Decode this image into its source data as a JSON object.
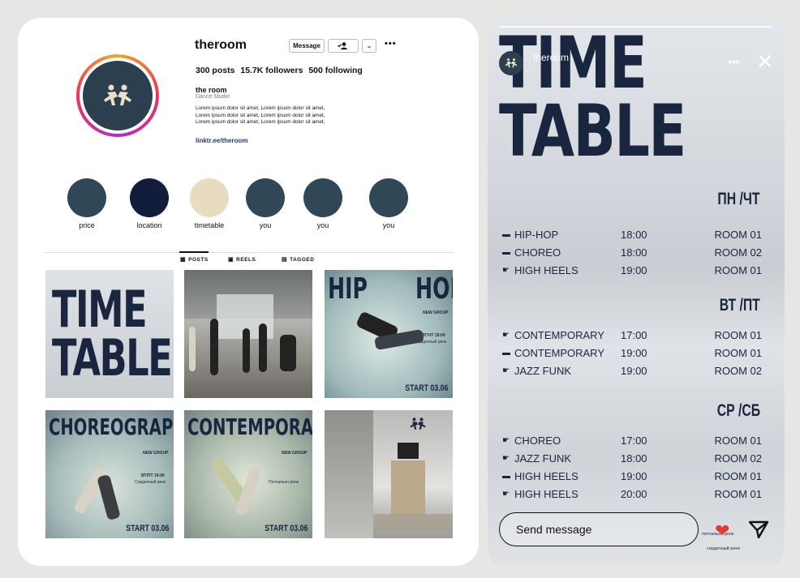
{
  "profile": {
    "username": "theroom",
    "message_button": "Message",
    "stats": {
      "posts": "300 posts",
      "followers": "15.7K followers",
      "following": "500 following"
    },
    "bio": {
      "name": "the room",
      "category": "Dance Studio",
      "text": "Lorem ipsum dolor sit amet, Lorem ipsum dolor sit amet, Lorem ipsum dolor sit amet, Lorem ipsum dolor sit amet, Lorem ipsum dolor sit amet, Lorem ipsum dolor sit amet,",
      "link": "linktr.ee/theroom"
    },
    "highlights": [
      {
        "label": "price",
        "color": "#2f4757"
      },
      {
        "label": "location",
        "color": "#121d3b"
      },
      {
        "label": "timetable",
        "color": "#e7dcc0"
      },
      {
        "label": "you",
        "color": "#2f4757"
      },
      {
        "label": "you",
        "color": "#2f4757"
      },
      {
        "label": "you",
        "color": "#2f4757"
      }
    ],
    "tabs": {
      "posts": "POSTS",
      "reels": "REELS",
      "tagged": "TAGGED"
    },
    "posts": {
      "timetable": {
        "line1": "TIME",
        "line2": "TABLE"
      },
      "hiphop": {
        "word1": "HIP",
        "word2": "HOP",
        "sub": "NEW GROUP",
        "days": "ВТ/ЧТ 19:00",
        "name": "Сердечный ренк",
        "start": "START 03.06"
      },
      "choreo": {
        "title": "CHOREOGRAPHY",
        "sub": "NEW GROUP",
        "days": "ВТ/ПТ 19:00",
        "name": "Сердечный ренк",
        "start": "START 03.06"
      },
      "contemp": {
        "title": "CONTEMPORARY",
        "sub": "NEW GROUP",
        "name": "Почтальон ренк",
        "start": "START 03.06"
      }
    }
  },
  "story": {
    "username": "theroom",
    "title_line1": "TIME",
    "title_line2": "TABLE",
    "days": [
      {
        "heading": "ПН /ЧТ",
        "rows": [
          {
            "mark": "dash",
            "class": "HIP-HOP",
            "time": "18:00",
            "room": "ROOM 01"
          },
          {
            "mark": "dash",
            "class": "CHOREO",
            "time": "18:00",
            "room": "ROOM 02"
          },
          {
            "mark": "hand",
            "class": "HIGH HEELS",
            "time": "19:00",
            "room": "ROOM 01"
          }
        ]
      },
      {
        "heading": "ВТ /ПТ",
        "rows": [
          {
            "mark": "hand",
            "class": "CONTEMPORARY",
            "time": "17:00",
            "room": "ROOM 01"
          },
          {
            "mark": "dash",
            "class": "CONTEMPORARY",
            "time": "19:00",
            "room": "ROOM 01"
          },
          {
            "mark": "hand",
            "class": "JAZZ FUNK",
            "time": "19:00",
            "room": "ROOM 02"
          }
        ]
      },
      {
        "heading": "СР /СБ",
        "rows": [
          {
            "mark": "hand",
            "class": "CHOREO",
            "time": "17:00",
            "room": "ROOM 01"
          },
          {
            "mark": "hand",
            "class": "JAZZ FUNK",
            "time": "18:00",
            "room": "ROOM 02"
          },
          {
            "mark": "dash",
            "class": "HIGH HEELS",
            "time": "19:00",
            "room": "ROOM 01"
          },
          {
            "mark": "hand",
            "class": "HIGH HEELS",
            "time": "20:00",
            "room": "ROOM 01"
          }
        ]
      }
    ],
    "send_message": "Send message",
    "tiny1": "почтальон ренк",
    "tiny2": "сердечный ренк"
  },
  "colors": {
    "navy": "#1a2540",
    "avatar": "#2b3f4e",
    "heart": "#e53935"
  }
}
